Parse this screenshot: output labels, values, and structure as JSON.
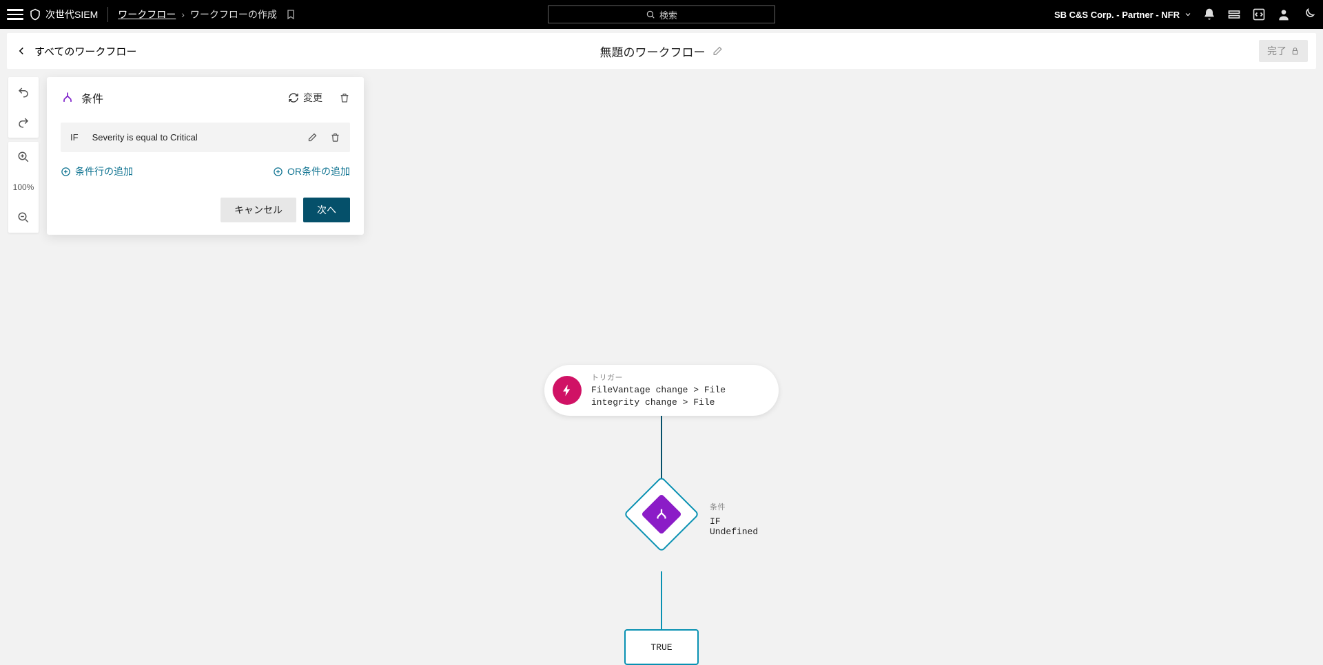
{
  "header": {
    "app_name": "次世代SIEM",
    "breadcrumb_link": "ワークフロー",
    "breadcrumb_current": "ワークフローの作成",
    "search_placeholder": "検索",
    "org_name": "SB C&S Corp. - Partner - NFR"
  },
  "subheader": {
    "back_label": "すべてのワークフロー",
    "title": "無題のワークフロー",
    "finish_label": "完了"
  },
  "tools": {
    "zoom_label": "100%"
  },
  "panel": {
    "title": "条件",
    "change_label": "変更",
    "condition": {
      "if_label": "IF",
      "expression": "Severity is equal to Critical"
    },
    "add_condition_label": "条件行の追加",
    "add_or_label": "OR条件の追加",
    "cancel_label": "キャンセル",
    "next_label": "次へ"
  },
  "diagram": {
    "trigger": {
      "label": "トリガー",
      "text": "FileVantage change > File integrity change > File"
    },
    "condition": {
      "label": "条件",
      "text": "IF Undefined"
    },
    "true_label": "TRUE"
  }
}
